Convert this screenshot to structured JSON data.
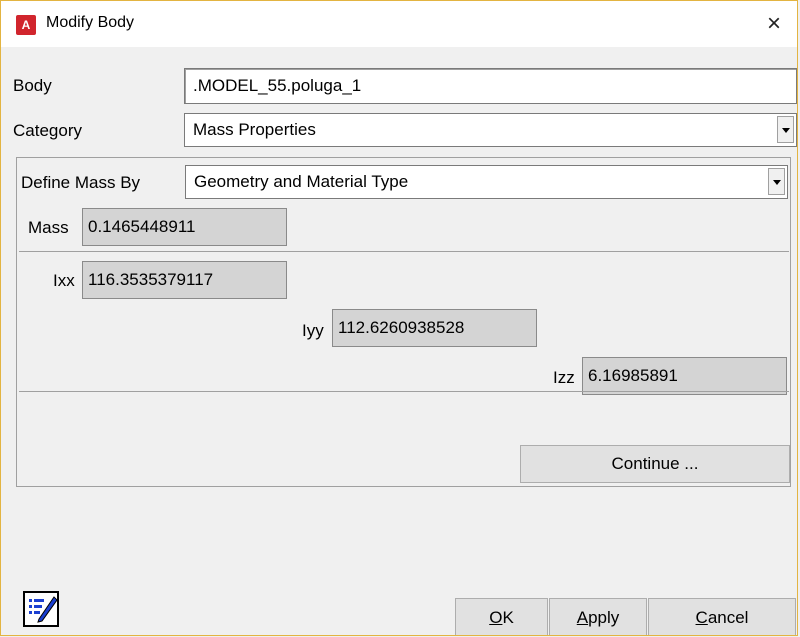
{
  "window": {
    "title": "Modify Body",
    "app_icon_letter": "A",
    "close_glyph": "×"
  },
  "body": {
    "label": "Body",
    "value": ".MODEL_55.poluga_1"
  },
  "category": {
    "label": "Category",
    "selected": "Mass Properties"
  },
  "define_mass": {
    "label": "Define Mass By",
    "selected": "Geometry and Material Type"
  },
  "mass": {
    "label": "Mass",
    "value": "0.1465448911"
  },
  "inertia": {
    "ixx": {
      "label": "Ixx",
      "value": "116.3535379117"
    },
    "iyy": {
      "label": "Iyy",
      "value": "112.6260938528"
    },
    "izz": {
      "label": "Izz",
      "value": "6.16985891"
    }
  },
  "buttons": {
    "continue": "Continue ...",
    "ok_mnemonic": "O",
    "ok_rest": "K",
    "apply_mnemonic": "A",
    "apply_rest": "pply",
    "cancel_mnemonic": "C",
    "cancel_rest": "ancel"
  },
  "icons": {
    "edit": "edit-notes-icon",
    "close": "close-icon",
    "dropdown": "chevron-down-icon"
  }
}
